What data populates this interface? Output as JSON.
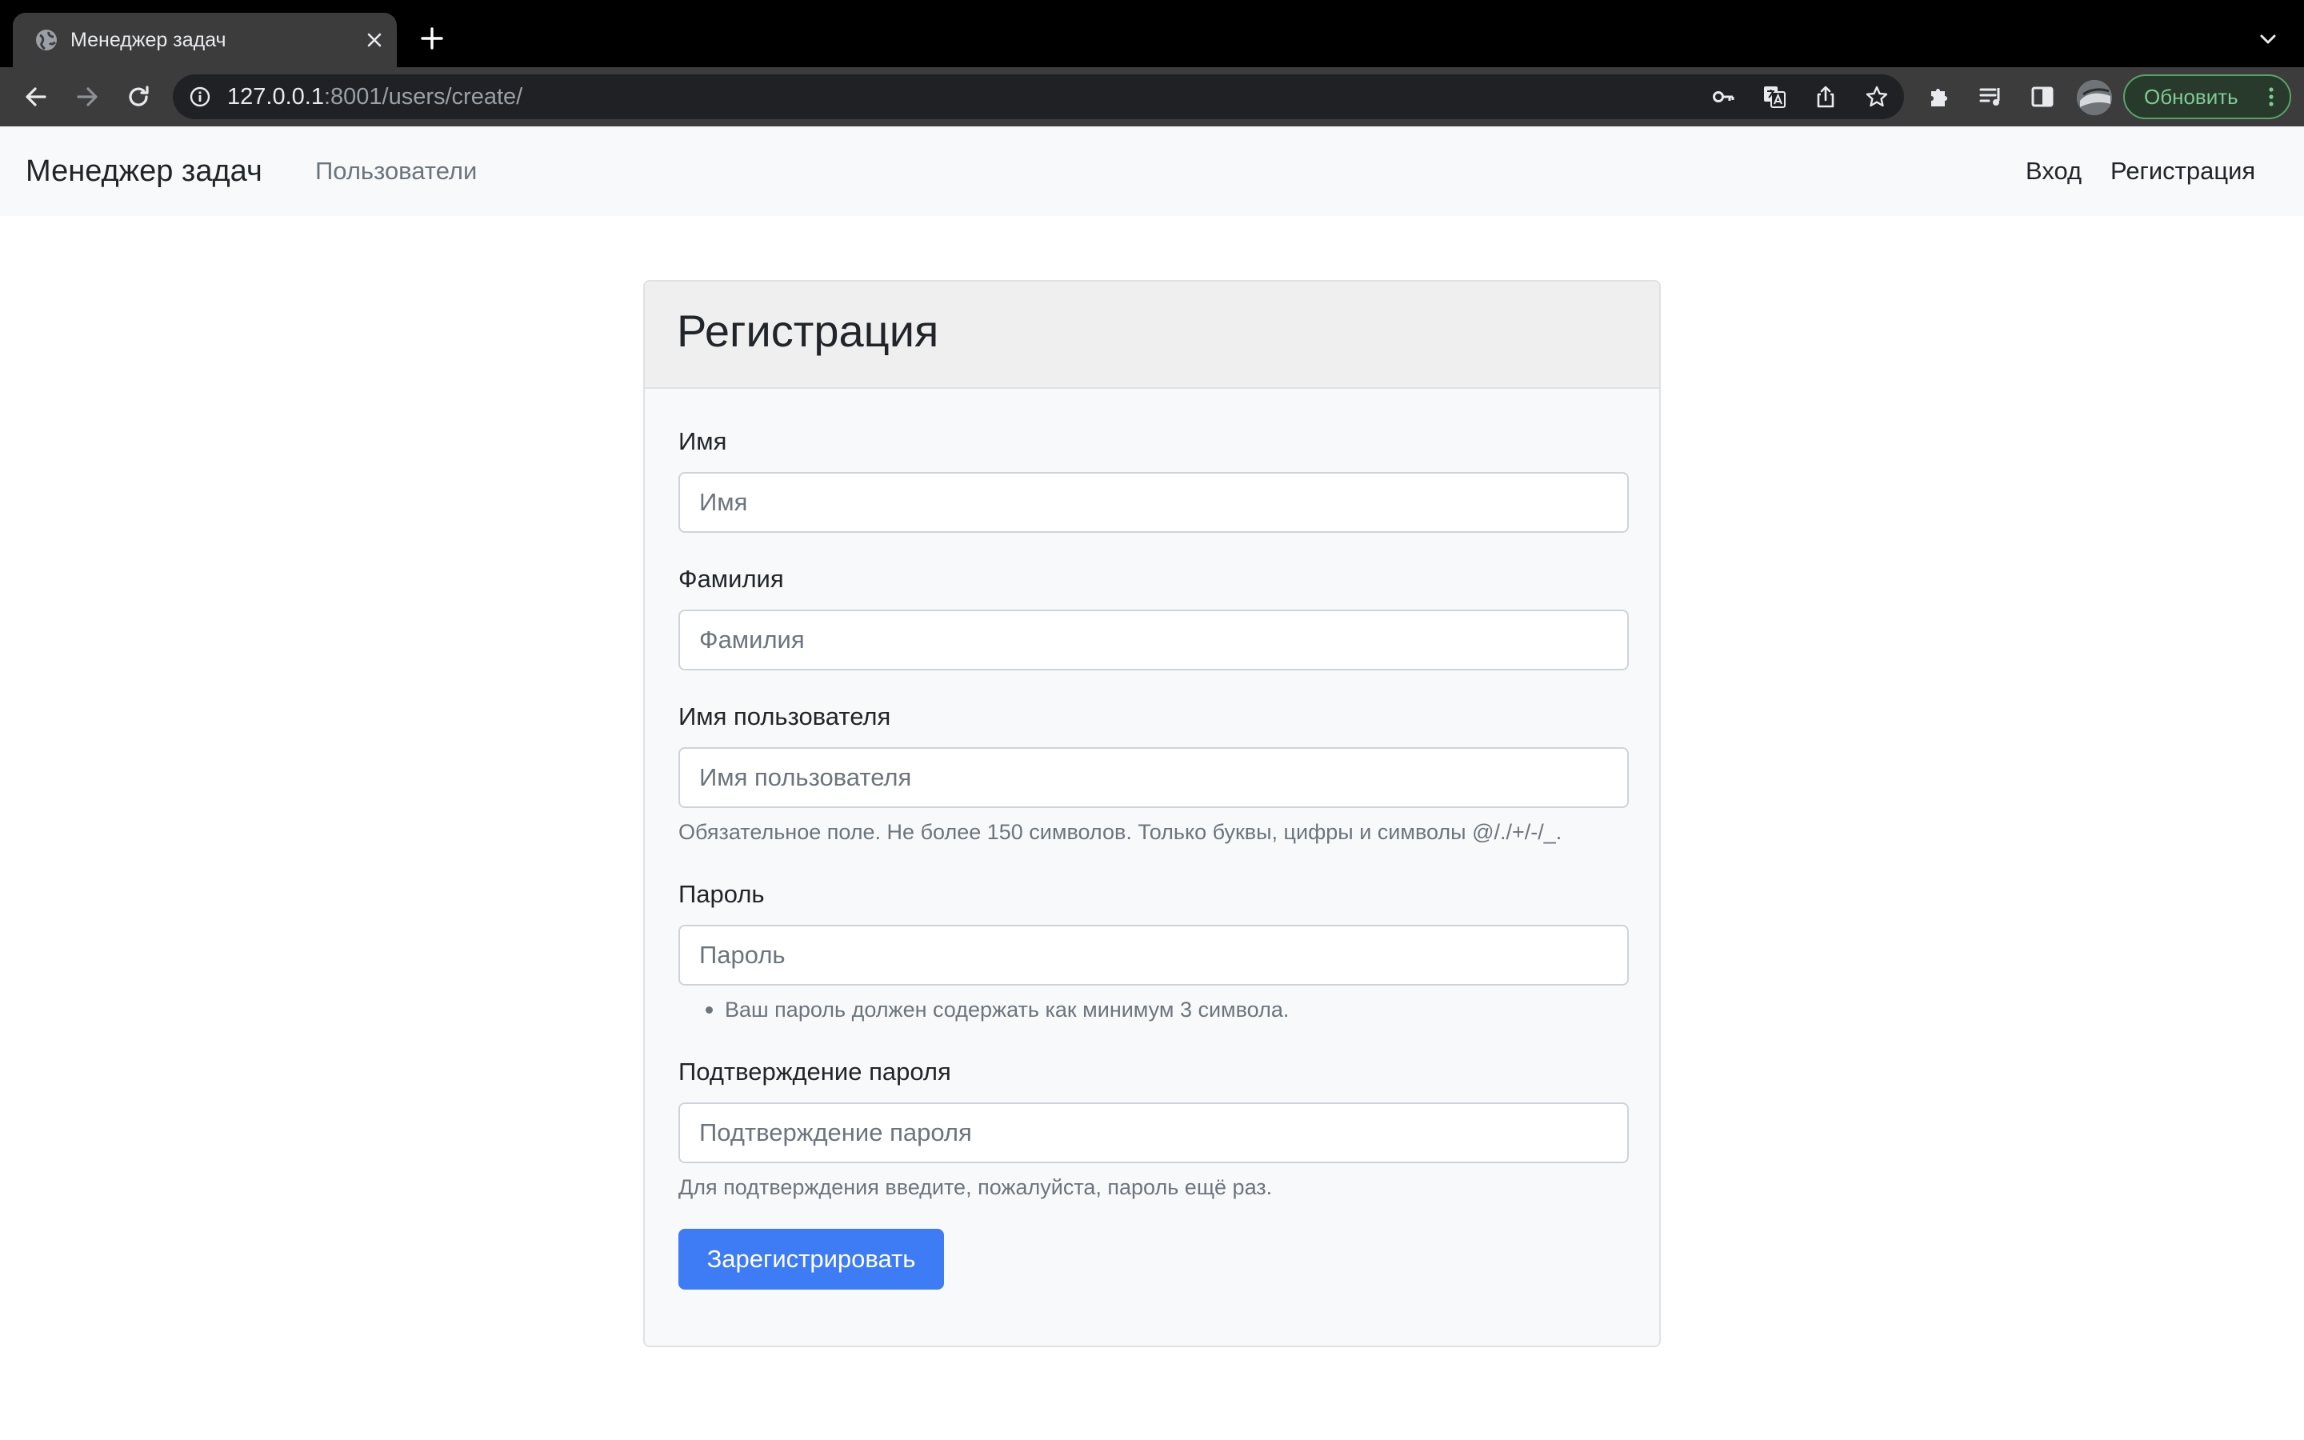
{
  "browser": {
    "tab_title": "Менеджер задач",
    "url_host": "127.0.0.1",
    "url_rest": ":8001/users/create/",
    "update_label": "Обновить"
  },
  "navbar": {
    "brand": "Менеджер задач",
    "users_link": "Пользователи",
    "login_link": "Вход",
    "signup_link": "Регистрация"
  },
  "form": {
    "title": "Регистрация",
    "first_name": {
      "label": "Имя",
      "placeholder": "Имя",
      "value": ""
    },
    "last_name": {
      "label": "Фамилия",
      "placeholder": "Фамилия",
      "value": ""
    },
    "username": {
      "label": "Имя пользователя",
      "placeholder": "Имя пользователя",
      "value": "",
      "help": "Обязательное поле. Не более 150 символов. Только буквы, цифры и символы @/./+/-/_."
    },
    "password1": {
      "label": "Пароль",
      "placeholder": "Пароль",
      "value": "",
      "help_items": [
        "Ваш пароль должен содержать как минимум 3 символа."
      ]
    },
    "password2": {
      "label": "Подтверждение пароля",
      "placeholder": "Подтверждение пароля",
      "value": "",
      "help": "Для подтверждения введите, пожалуйста, пароль ещё раз."
    },
    "submit_label": "Зарегистрировать"
  },
  "colors": {
    "primary": "#3d7cf5",
    "navbar_bg": "#f8f9fa",
    "card_header_bg": "#efefef",
    "muted_text": "#6c757d",
    "chrome_dark": "#3c3c3c",
    "update_green": "#81c995"
  },
  "icons": {
    "tab_favicon": "globe-icon",
    "tab_close": "close-icon",
    "new_tab": "plus-icon",
    "tab_search": "chevron-down-icon",
    "back": "arrow-left-icon",
    "forward": "arrow-right-icon",
    "reload": "reload-icon",
    "site_info": "info-icon",
    "password": "key-icon",
    "translate": "translate-icon",
    "share": "share-icon",
    "bookmark": "star-icon",
    "extensions": "puzzle-icon",
    "media": "playlist-icon",
    "side_panel": "side-panel-icon",
    "profile": "avatar",
    "menu": "kebab-menu-icon"
  }
}
